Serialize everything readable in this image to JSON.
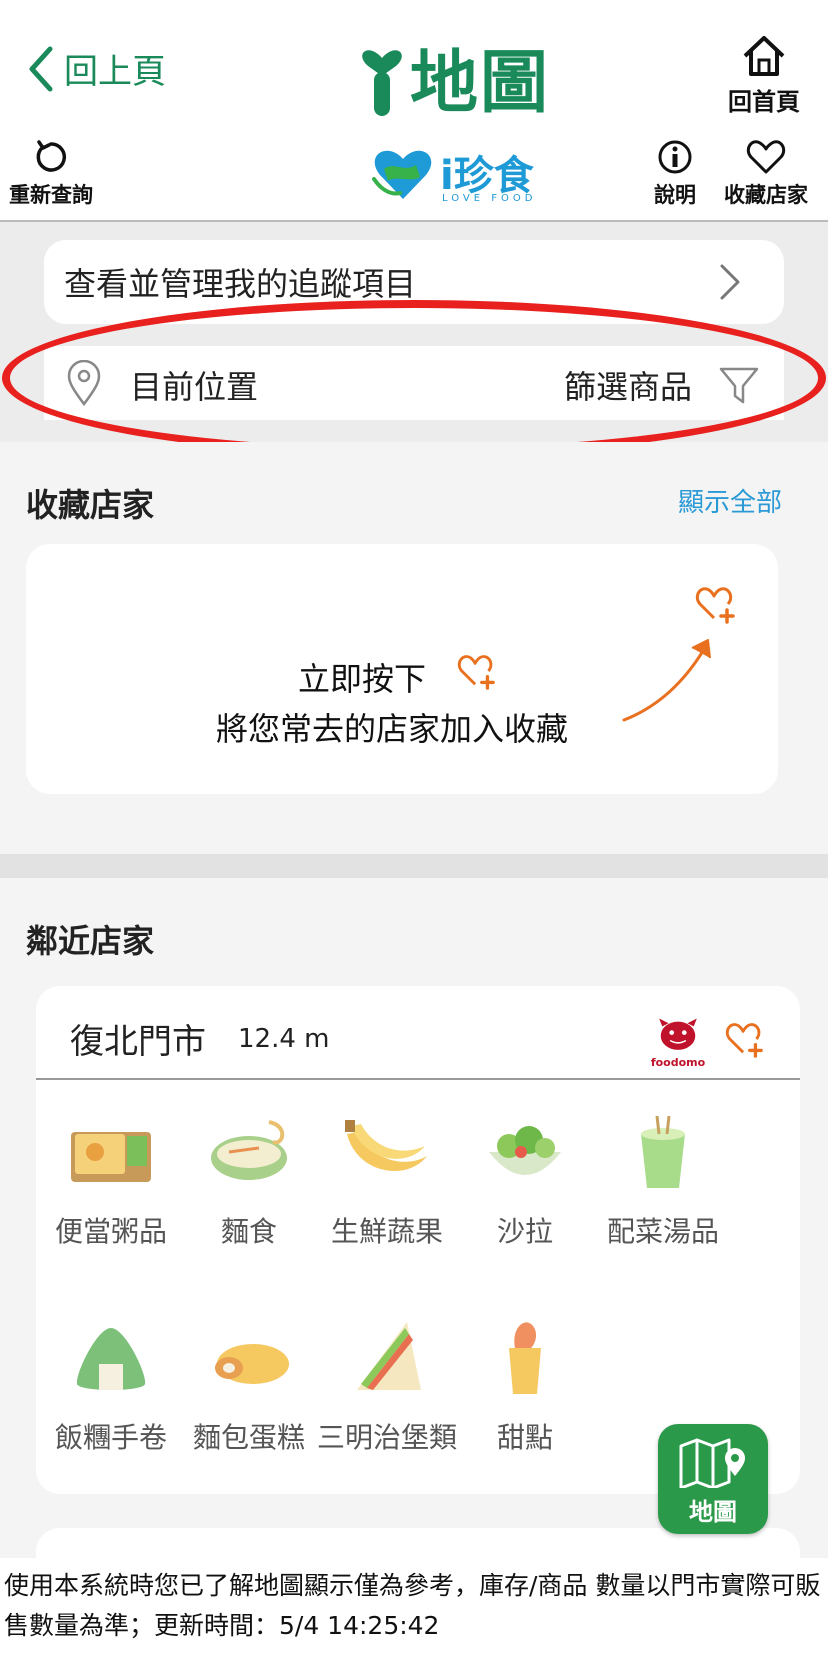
{
  "header": {
    "back_label": "回上頁",
    "app_title": "地圖",
    "home_label": "回首頁"
  },
  "toolbar": {
    "refresh_label": "重新查詢",
    "brand_name": "珍食",
    "brand_sub": "LOVE FOOD",
    "info_label": "說明",
    "fav_stores_label": "收藏店家"
  },
  "filters": {
    "track_label": "查看並管理我的追蹤項目",
    "location_label": "目前位置",
    "filter_label": "篩選商品"
  },
  "favorites": {
    "title": "收藏店家",
    "show_all": "顯示全部",
    "hint_line1": "立即按下",
    "hint_line2": "將您常去的店家加入收藏"
  },
  "nearby": {
    "title": "鄰近店家",
    "store": {
      "name": "復北門市",
      "distance": "12.4 m",
      "brand": "foodomo"
    },
    "categories": [
      {
        "label": "便當粥品",
        "icon": "bento-icon"
      },
      {
        "label": "麵食",
        "icon": "noodle-icon"
      },
      {
        "label": "生鮮蔬果",
        "icon": "banana-icon"
      },
      {
        "label": "沙拉",
        "icon": "salad-icon"
      },
      {
        "label": "配菜湯品",
        "icon": "soup-cup-icon"
      },
      {
        "label": "飯糰手卷",
        "icon": "onigiri-icon"
      },
      {
        "label": "麵包蛋糕",
        "icon": "bread-icon"
      },
      {
        "label": "三明治堡類",
        "icon": "sandwich-icon"
      },
      {
        "label": "甜點",
        "icon": "dessert-icon"
      }
    ]
  },
  "map_button_label": "地圖",
  "footer_text": "使用本系統時您已了解地圖顯示僅為參考，庫存/商品 數量以門市實際可販售數量為準；更新時間：5/4 14:25:42",
  "colors": {
    "brand_green": "#1a8a5a",
    "accent_blue": "#2a9ad6",
    "heart_orange": "#e8701e",
    "highlight_red": "#e8211e",
    "map_button_green": "#2a9a4a"
  }
}
